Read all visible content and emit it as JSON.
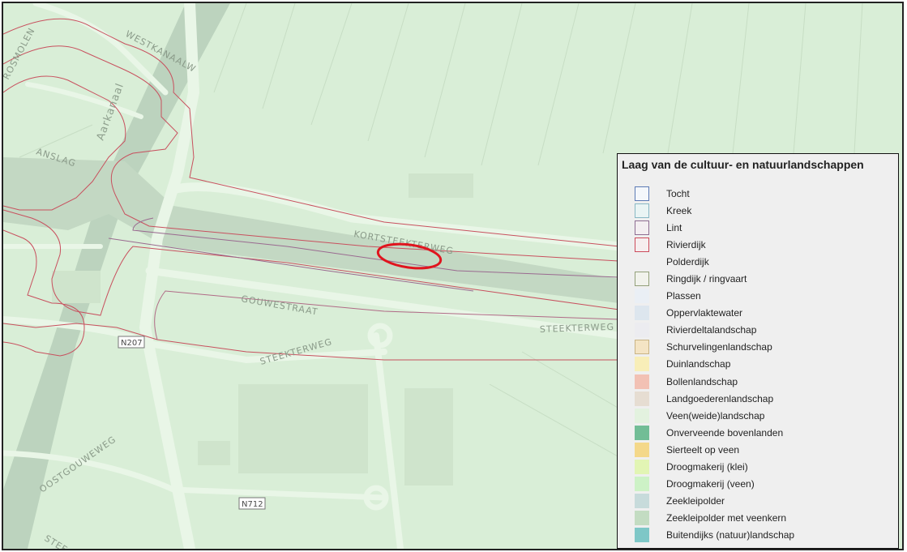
{
  "map": {
    "road_labels": {
      "westkanaalweg": "WESTKANAALW",
      "rosmolen": "ROSMOLEN",
      "anslag": "ANSLAG",
      "aarkanaal": "Aarkanaal",
      "kortsteekterweg": "KORTSTEEKTERWEG",
      "gouwestraat": "GOUWESTRAAT",
      "steekterweg_east": "STEEKTERWEG",
      "steekterweg_south": "STEEKTERWEG",
      "oostgouweweg": "OOSTGOUWEWEG",
      "stee": "STEE"
    },
    "shields": {
      "n207": "N207",
      "n712": "N712"
    },
    "colors": {
      "background": "#d9eed7",
      "water": "#b9d3bd",
      "road": "#e8f5e6",
      "polygon_line": "#c8505e",
      "highlight_ellipse": "#e0141e"
    },
    "highlight_marker": "red ellipse around Kortsteekterweg"
  },
  "legend": {
    "title": "Laag van de cultuur- en natuurlandschappen",
    "items": [
      {
        "label": "Tocht",
        "fill": "#f4f7fb",
        "border": "#5c7ab5",
        "border_width": 1
      },
      {
        "label": "Kreek",
        "fill": "#e9f4f4",
        "border": "#88b8c4",
        "border_width": 1
      },
      {
        "label": "Lint",
        "fill": "#f3eef1",
        "border": "#8e6d92",
        "border_width": 1
      },
      {
        "label": "Rivierdijk",
        "fill": "#f6eeef",
        "border": "#cc4b5b",
        "border_width": 1
      },
      {
        "label": "Polderdijk",
        "fill": "#efefef",
        "border": "#efefef",
        "border_width": 0
      },
      {
        "label": "Ringdijk / ringvaart",
        "fill": "#f1f2ec",
        "border": "#93a07a",
        "border_width": 1
      },
      {
        "label": "Plassen",
        "fill": "#eaeff5",
        "border": "#eaeff5",
        "border_width": 0
      },
      {
        "label": "Oppervlaktewater",
        "fill": "#dde6ee",
        "border": "#dde6ee",
        "border_width": 0
      },
      {
        "label": "Rivierdeltalandschap",
        "fill": "#ececf0",
        "border": "#ececf0",
        "border_width": 0
      },
      {
        "label": "Schurvelingenlandschap",
        "fill": "#f4e4c4",
        "border": "#c9b485",
        "border_width": 1
      },
      {
        "label": "Duinlandschap",
        "fill": "#f8eeb8",
        "border": "#f8eeb8",
        "border_width": 0
      },
      {
        "label": "Bollenlandschap",
        "fill": "#f2c1b4",
        "border": "#f2c1b4",
        "border_width": 0
      },
      {
        "label": "Landgoederenlandschap",
        "fill": "#e6ddd2",
        "border": "#e6ddd2",
        "border_width": 0
      },
      {
        "label": "Veen(weide)landschap",
        "fill": "#e3f2df",
        "border": "#e3f2df",
        "border_width": 0
      },
      {
        "label": "Onverveende bovenlanden",
        "fill": "#72bd96",
        "border": "#72bd96",
        "border_width": 0
      },
      {
        "label": "Sierteelt op veen",
        "fill": "#f4d88a",
        "border": "#f4d88a",
        "border_width": 0
      },
      {
        "label": "Droogmakerij (klei)",
        "fill": "#e2f5b4",
        "border": "#e2f5b4",
        "border_width": 0
      },
      {
        "label": "Droogmakerij (veen)",
        "fill": "#cdf2c6",
        "border": "#cdf2c6",
        "border_width": 0
      },
      {
        "label": "Zeekleipolder",
        "fill": "#c7dbdb",
        "border": "#c7dbdb",
        "border_width": 0
      },
      {
        "label": "Zeekleipolder met veenkern",
        "fill": "#c3dcc2",
        "border": "#c3dcc2",
        "border_width": 0
      },
      {
        "label": "Buitendijks (natuur)landschap",
        "fill": "#7ec7c7",
        "border": "#7ec7c7",
        "border_width": 0
      }
    ]
  }
}
